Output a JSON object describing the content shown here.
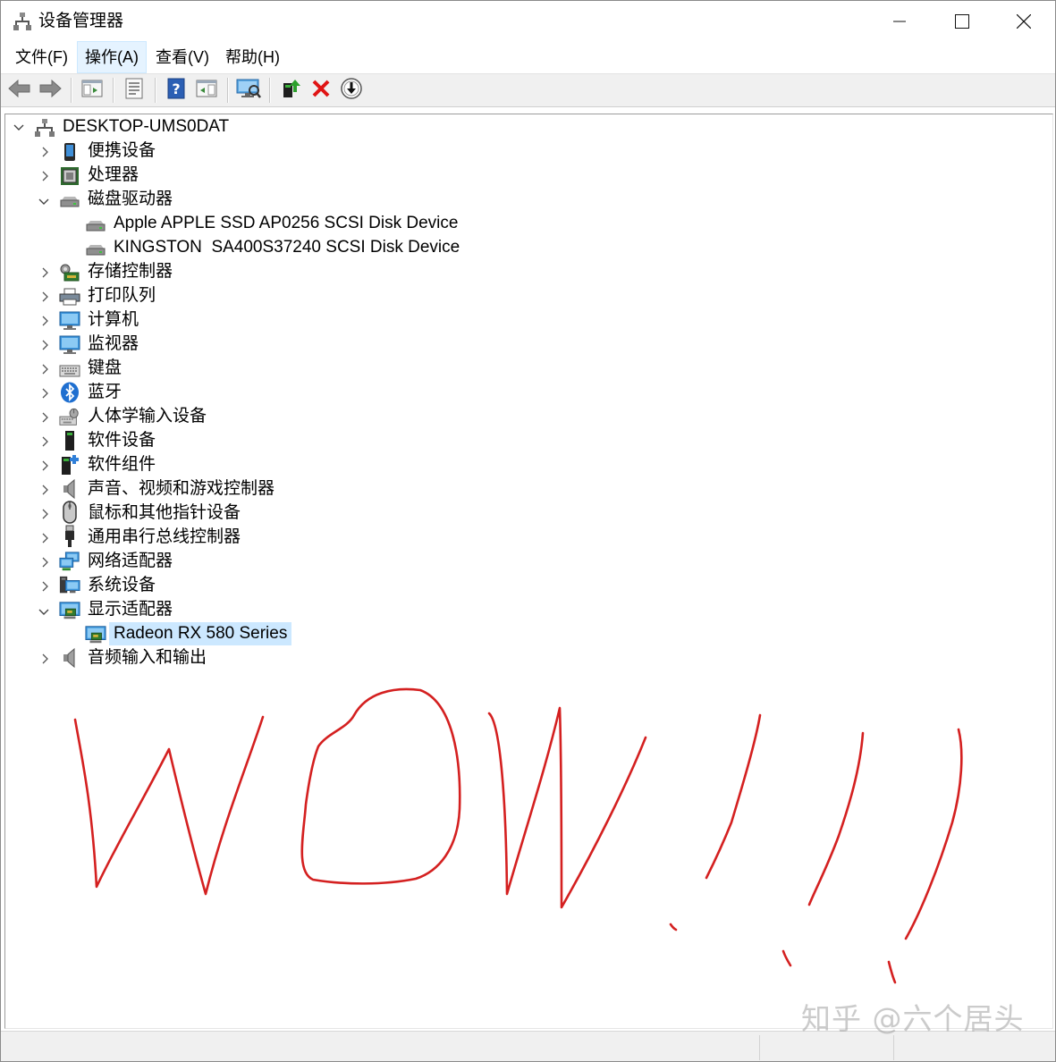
{
  "window": {
    "title": "设备管理器",
    "icon": "device-manager-icon"
  },
  "window_buttons": {
    "minimize": "minimize-icon",
    "maximize": "maximize-icon",
    "close": "close-icon"
  },
  "menu": {
    "items": [
      {
        "label": "文件(F)",
        "highlighted": false
      },
      {
        "label": "操作(A)",
        "highlighted": true
      },
      {
        "label": "查看(V)",
        "highlighted": false
      },
      {
        "label": "帮助(H)",
        "highlighted": false
      }
    ]
  },
  "toolbar": {
    "buttons": [
      "back-arrow-icon",
      "forward-arrow-icon",
      "show-hide-console-tree-icon",
      "properties-icon",
      "help-icon",
      "action-pane-icon",
      "scan-hardware-icon",
      "update-driver-icon",
      "uninstall-device-icon",
      "disable-device-icon"
    ]
  },
  "tree": {
    "root": {
      "label": "DESKTOP-UMS0DAT",
      "expanded": true,
      "icon": "computer-icon"
    },
    "nodes": [
      {
        "label": "便携设备",
        "icon": "portable-device-icon",
        "expanded": false,
        "level": 1
      },
      {
        "label": "处理器",
        "icon": "processor-icon",
        "expanded": false,
        "level": 1
      },
      {
        "label": "磁盘驱动器",
        "icon": "disk-drive-icon",
        "expanded": true,
        "level": 1
      },
      {
        "label": "Apple APPLE SSD AP0256 SCSI Disk Device",
        "icon": "disk-drive-icon",
        "level": 2
      },
      {
        "label": "KINGSTON  SA400S37240 SCSI Disk Device",
        "icon": "disk-drive-icon",
        "level": 2
      },
      {
        "label": "存储控制器",
        "icon": "storage-controller-icon",
        "expanded": false,
        "level": 1
      },
      {
        "label": "打印队列",
        "icon": "printer-icon",
        "expanded": false,
        "level": 1
      },
      {
        "label": "计算机",
        "icon": "computer-monitor-icon",
        "expanded": false,
        "level": 1
      },
      {
        "label": "监视器",
        "icon": "monitor-icon",
        "expanded": false,
        "level": 1
      },
      {
        "label": "键盘",
        "icon": "keyboard-icon",
        "expanded": false,
        "level": 1
      },
      {
        "label": "蓝牙",
        "icon": "bluetooth-icon",
        "expanded": false,
        "level": 1
      },
      {
        "label": "人体学输入设备",
        "icon": "hid-icon",
        "expanded": false,
        "level": 1
      },
      {
        "label": "软件设备",
        "icon": "software-device-icon",
        "expanded": false,
        "level": 1
      },
      {
        "label": "软件组件",
        "icon": "software-component-icon",
        "expanded": false,
        "level": 1
      },
      {
        "label": "声音、视频和游戏控制器",
        "icon": "speaker-icon",
        "expanded": false,
        "level": 1
      },
      {
        "label": "鼠标和其他指针设备",
        "icon": "mouse-icon",
        "expanded": false,
        "level": 1
      },
      {
        "label": "通用串行总线控制器",
        "icon": "usb-icon",
        "expanded": false,
        "level": 1
      },
      {
        "label": "网络适配器",
        "icon": "network-adapter-icon",
        "expanded": false,
        "level": 1
      },
      {
        "label": "系统设备",
        "icon": "system-device-icon",
        "expanded": false,
        "level": 1
      },
      {
        "label": "显示适配器",
        "icon": "display-adapter-icon",
        "expanded": true,
        "level": 1
      },
      {
        "label": "Radeon RX 580 Series",
        "icon": "display-adapter-icon",
        "level": 2,
        "selected": true
      },
      {
        "label": "音频输入和输出",
        "icon": "speaker-icon",
        "expanded": false,
        "level": 1
      }
    ]
  },
  "annotation": {
    "handwriting": "WOW!!!",
    "ink_color": "#d42020"
  },
  "watermark": "知乎 @六个居头",
  "colors": {
    "selection": "#cce8ff",
    "menu_hover": "#e5f3ff",
    "toolbar_bg": "#f0f0f0"
  }
}
